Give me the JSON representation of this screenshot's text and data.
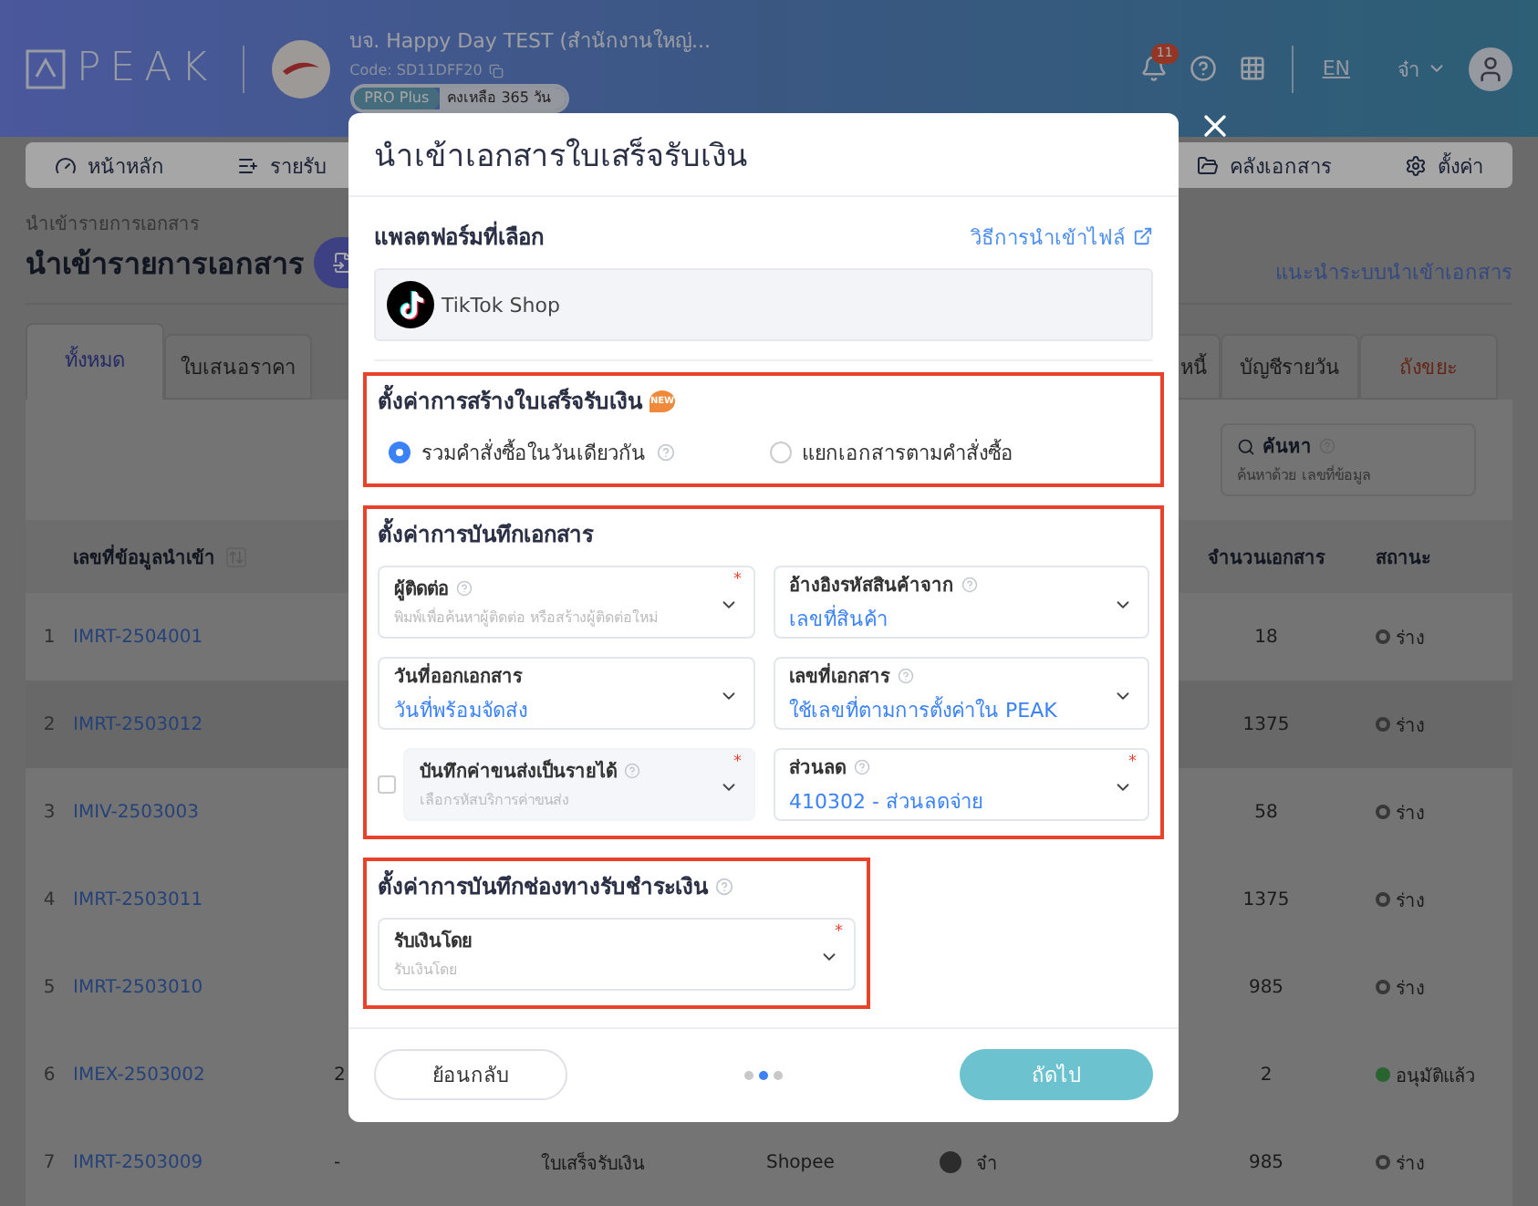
{
  "header": {
    "logo": "PEAK",
    "company": "บจ. Happy Day TEST (สำนักงานใหญ่...",
    "code": "Code: SD11DFF20",
    "plan": "PRO Plus",
    "remaining": "คงเหลือ 365 วัน",
    "notifications": "11",
    "language": "EN",
    "user": "จ๋า"
  },
  "nav": [
    {
      "label": "หน้าหลัก"
    },
    {
      "label": "รายรับ"
    },
    {
      "label": "คลังเอกสาร"
    },
    {
      "label": "ตั้งค่า"
    }
  ],
  "page": {
    "breadcrumb": "นำเข้ารายการเอกสาร",
    "title": "นำเข้ารายการเอกสาร",
    "guide_link": "แนะนำระบบนำเข้าเอกสาร"
  },
  "tabs": [
    {
      "label": "ทั้งหมด",
      "selected": true,
      "kind": "normal"
    },
    {
      "label": "ใบเสนอราคา",
      "selected": false,
      "kind": "normal"
    },
    {
      "label": "หนี้",
      "selected": false,
      "kind": "partial"
    },
    {
      "label": "บัญชีรายวัน",
      "selected": false,
      "kind": "normal"
    },
    {
      "label": "ถังขยะ",
      "selected": false,
      "kind": "trash"
    }
  ],
  "search": {
    "label": "ค้นหา",
    "placeholder": "ค้นหาด้วย เลขที่ข้อมูล"
  },
  "table": {
    "columns": [
      "เลขที่ข้อมูลนำเข้า",
      "จำนวนเอกสาร",
      "สถานะ"
    ],
    "rows": [
      {
        "index": "1",
        "id": "IMRT-2504001",
        "count": "18",
        "status": "ร่าง",
        "approved": false,
        "highlighted": false
      },
      {
        "index": "2",
        "id": "IMRT-2503012",
        "count": "1375",
        "status": "ร่าง",
        "approved": false,
        "highlighted": true
      },
      {
        "index": "3",
        "id": "IMIV-2503003",
        "count": "58",
        "status": "ร่าง",
        "approved": false,
        "highlighted": false
      },
      {
        "index": "4",
        "id": "IMRT-2503011",
        "count": "1375",
        "status": "ร่าง",
        "approved": false,
        "highlighted": false
      },
      {
        "index": "5",
        "id": "IMRT-2503010",
        "count": "985",
        "status": "ร่าง",
        "approved": false,
        "highlighted": false
      },
      {
        "index": "6",
        "id": "IMEX-2503002",
        "column_3": "2",
        "count": "2",
        "status": "อนุมัติแล้ว",
        "approved": true,
        "highlighted": false
      },
      {
        "index": "7",
        "id": "IMRT-2503009",
        "column_3": "-",
        "type": "ใบเสร็จรับเงิน",
        "channel": "Shopee",
        "creator": "จ๋า",
        "count": "985",
        "status": "ร่าง",
        "approved": false,
        "highlighted": false
      }
    ]
  },
  "modal": {
    "title": "นำเข้าเอกสารใบเสร็จรับเงิน",
    "platform_heading": "แพลตฟอร์มที่เลือก",
    "how_to_link": "วิธีการนำเข้าไฟล์",
    "platform": "TikTok Shop",
    "creation_heading": "ตั้งค่าการสร้างใบเสร็จรับเงิน",
    "new_badge": "NEW",
    "creation_options": [
      {
        "label": "รวมคำสั่งซื้อในวันเดียวกัน",
        "selected": true,
        "help": true
      },
      {
        "label": "แยกเอกสารตามคำสั่งซื้อ",
        "selected": false,
        "help": false
      }
    ],
    "record_heading": "ตั้งค่าการบันทึกเอกสาร",
    "record_fields": [
      {
        "label": "ผู้ติดต่อ",
        "help": true,
        "required_mark": "*",
        "placeholder": "พิมพ์เพื่อค้นหาผู้ติดต่อ หรือสร้างผู้ติดต่อใหม่",
        "disabled": false
      },
      {
        "label": "อ้างอิงรหัสสินค้าจาก",
        "help": true,
        "value": "เลขที่สินค้า",
        "disabled": false
      },
      {
        "label": "วันที่ออกเอกสาร",
        "help": false,
        "value": "วันที่พร้อมจัดส่ง",
        "disabled": false
      },
      {
        "label": "เลขที่เอกสาร",
        "help": true,
        "value": "ใช้เลขที่ตามการตั้งค่าใน PEAK",
        "disabled": false
      },
      {
        "label": "บันทึกค่าขนส่งเป็นรายได้",
        "help": true,
        "required_mark": "*",
        "placeholder": "เลือกรหัสบริการค่าขนส่ง",
        "disabled": true,
        "checked": false
      },
      {
        "label": "ส่วนลด",
        "help": true,
        "required_mark": "*",
        "value": "410302 - ส่วนลดจ่าย",
        "disabled": false
      }
    ],
    "payment_heading": "ตั้งค่าการบันทึกช่องทางรับชำระเงิน",
    "payment_fields": [
      {
        "label": "รับเงินโดย",
        "help": false,
        "required_mark": "*",
        "placeholder": "รับเงินโดย",
        "disabled": false
      }
    ],
    "steps": [
      {
        "selected": false
      },
      {
        "selected": true
      },
      {
        "selected": false
      }
    ],
    "back_button": "ย้อนกลับ",
    "next_button": "ถัดไป"
  }
}
